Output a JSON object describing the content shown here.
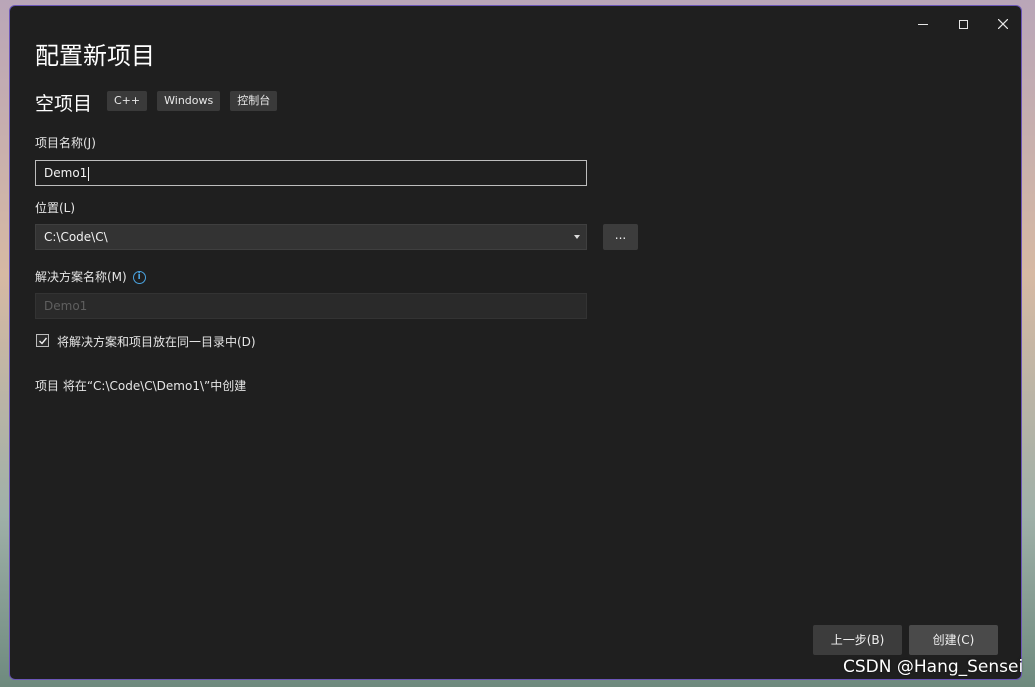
{
  "dialog": {
    "title": "配置新项目",
    "template_name": "空项目",
    "tags": [
      "C++",
      "Windows",
      "控制台"
    ]
  },
  "project_name": {
    "label": "项目名称(J)",
    "value": "Demo1"
  },
  "location": {
    "label": "位置(L)",
    "value": "C:\\Code\\C\\",
    "browse_label": "..."
  },
  "solution_name": {
    "label": "解决方案名称(M)",
    "value": "Demo1",
    "info_icon": "info-icon"
  },
  "same_directory": {
    "label": "将解决方案和项目放在同一目录中(D)",
    "checked": true
  },
  "path_note": "项目 将在“C:\\Code\\C\\Demo1\\”中创建",
  "buttons": {
    "back": "上一步(B)",
    "create": "创建(C)"
  },
  "watermark": "CSDN @Hang_Sensei",
  "colors": {
    "dialog_bg": "#1f1f1f",
    "border_accent": "#6b56b7",
    "info_blue": "#4aa3e0"
  }
}
